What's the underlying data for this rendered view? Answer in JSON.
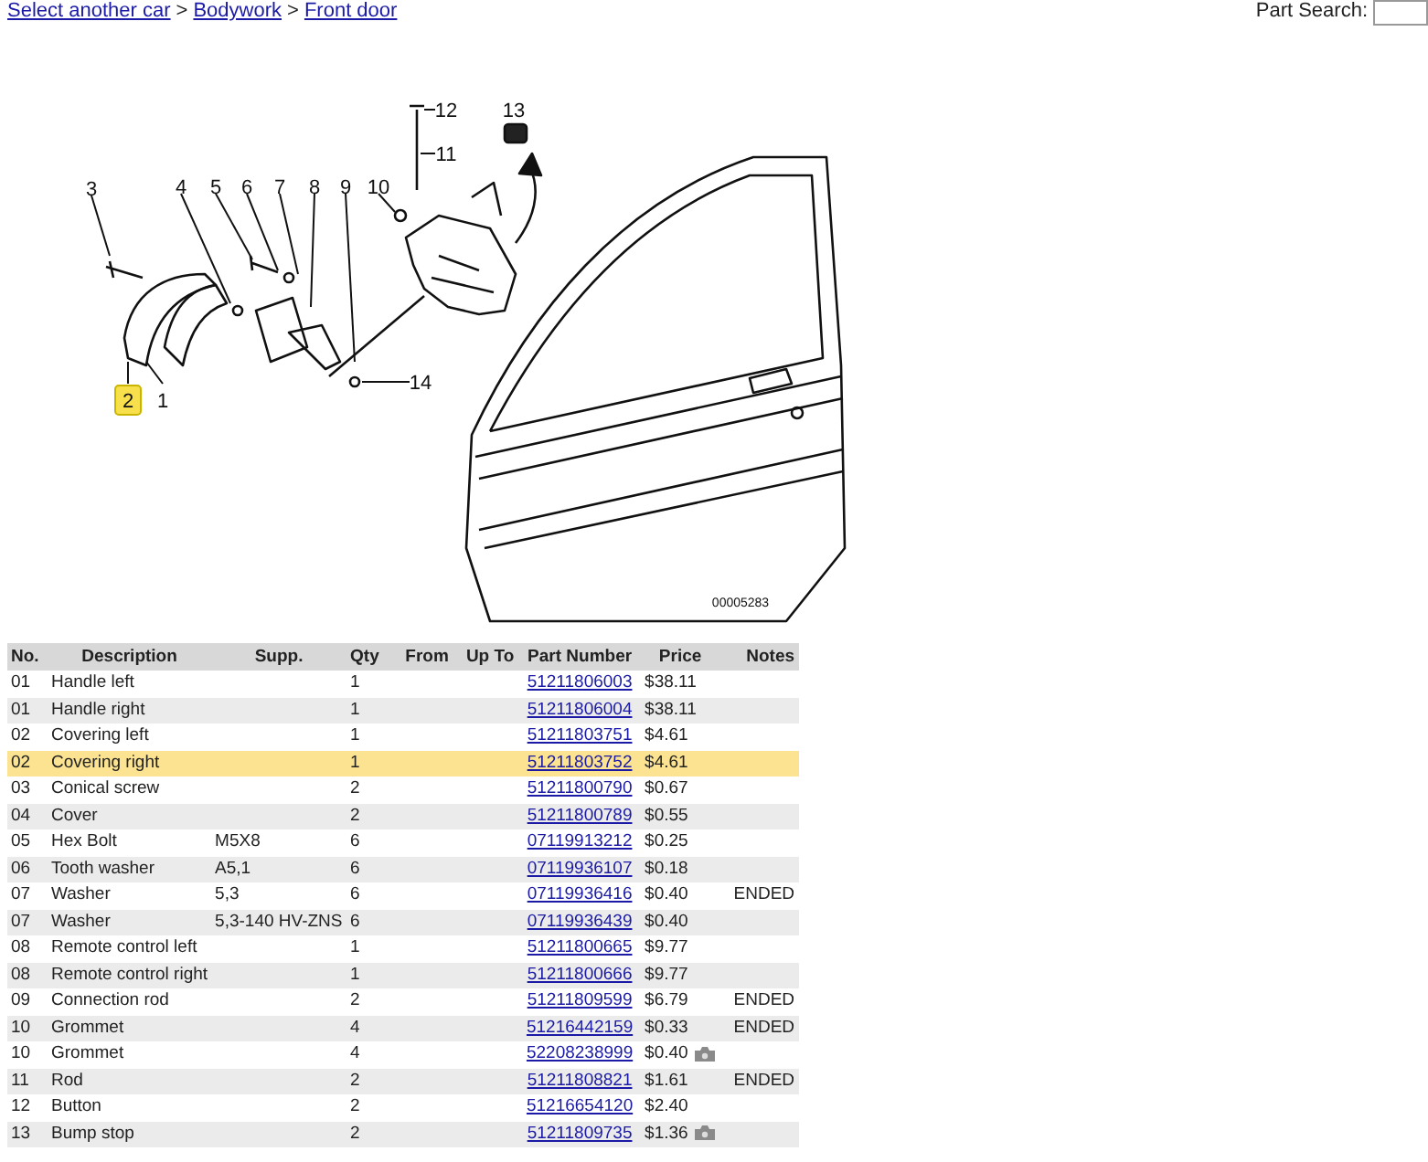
{
  "breadcrumb": [
    {
      "label": "Select another car"
    },
    {
      "label": "Bodywork"
    },
    {
      "label": "Front door"
    }
  ],
  "breadcrumb_separator": ">",
  "search": {
    "label": "Part Search:"
  },
  "diagram": {
    "code": "00005283",
    "callouts": [
      {
        "label": "3",
        "selected": false
      },
      {
        "label": "4",
        "selected": false
      },
      {
        "label": "5",
        "selected": false
      },
      {
        "label": "6",
        "selected": false
      },
      {
        "label": "7",
        "selected": false
      },
      {
        "label": "8",
        "selected": false
      },
      {
        "label": "9",
        "selected": false
      },
      {
        "label": "10",
        "selected": false
      },
      {
        "label": "12",
        "selected": false
      },
      {
        "label": "11",
        "selected": false
      },
      {
        "label": "13",
        "selected": false
      },
      {
        "label": "2",
        "selected": true
      },
      {
        "label": "1",
        "selected": false
      },
      {
        "label": "14",
        "selected": false
      }
    ]
  },
  "table": {
    "columns": [
      "No.",
      "Description",
      "Supp.",
      "Qty",
      "From",
      "Up To",
      "Part Number",
      "Price",
      "Notes"
    ],
    "rows": [
      {
        "no": "01",
        "description": "Handle left",
        "supp": "",
        "qty": "1",
        "part_number": "51211806003",
        "price": "$38.11",
        "notes": "",
        "photo": false,
        "selected": false
      },
      {
        "no": "01",
        "description": "Handle right",
        "supp": "",
        "qty": "1",
        "part_number": "51211806004",
        "price": "$38.11",
        "notes": "",
        "photo": false,
        "selected": false
      },
      {
        "no": "02",
        "description": "Covering left",
        "supp": "",
        "qty": "1",
        "part_number": "51211803751",
        "price": "$4.61",
        "notes": "",
        "photo": false,
        "selected": false
      },
      {
        "no": "02",
        "description": "Covering right",
        "supp": "",
        "qty": "1",
        "part_number": "51211803752",
        "price": "$4.61",
        "notes": "",
        "photo": false,
        "selected": true
      },
      {
        "no": "03",
        "description": "Conical screw",
        "supp": "",
        "qty": "2",
        "part_number": "51211800790",
        "price": "$0.67",
        "notes": "",
        "photo": false,
        "selected": false
      },
      {
        "no": "04",
        "description": "Cover",
        "supp": "",
        "qty": "2",
        "part_number": "51211800789",
        "price": "$0.55",
        "notes": "",
        "photo": false,
        "selected": false
      },
      {
        "no": "05",
        "description": "Hex Bolt",
        "supp": "M5X8",
        "qty": "6",
        "part_number": "07119913212",
        "price": "$0.25",
        "notes": "",
        "photo": false,
        "selected": false
      },
      {
        "no": "06",
        "description": "Tooth washer",
        "supp": "A5,1",
        "qty": "6",
        "part_number": "07119936107",
        "price": "$0.18",
        "notes": "",
        "photo": false,
        "selected": false
      },
      {
        "no": "07",
        "description": "Washer",
        "supp": "5,3",
        "qty": "6",
        "part_number": "07119936416",
        "price": "$0.40",
        "notes": "ENDED",
        "photo": false,
        "selected": false
      },
      {
        "no": "07",
        "description": "Washer",
        "supp": "5,3-140 HV-ZNS",
        "qty": "6",
        "part_number": "07119936439",
        "price": "$0.40",
        "notes": "",
        "photo": false,
        "selected": false
      },
      {
        "no": "08",
        "description": "Remote control left",
        "supp": "",
        "qty": "1",
        "part_number": "51211800665",
        "price": "$9.77",
        "notes": "",
        "photo": false,
        "selected": false
      },
      {
        "no": "08",
        "description": "Remote control right",
        "supp": "",
        "qty": "1",
        "part_number": "51211800666",
        "price": "$9.77",
        "notes": "",
        "photo": false,
        "selected": false
      },
      {
        "no": "09",
        "description": "Connection rod",
        "supp": "",
        "qty": "2",
        "part_number": "51211809599",
        "price": "$6.79",
        "notes": "ENDED",
        "photo": false,
        "selected": false
      },
      {
        "no": "10",
        "description": "Grommet",
        "supp": "",
        "qty": "4",
        "part_number": "51216442159",
        "price": "$0.33",
        "notes": "ENDED",
        "photo": false,
        "selected": false
      },
      {
        "no": "10",
        "description": "Grommet",
        "supp": "",
        "qty": "4",
        "part_number": "52208238999",
        "price": "$0.40",
        "notes": "",
        "photo": true,
        "selected": false
      },
      {
        "no": "11",
        "description": "Rod",
        "supp": "",
        "qty": "2",
        "part_number": "51211808821",
        "price": "$1.61",
        "notes": "ENDED",
        "photo": false,
        "selected": false
      },
      {
        "no": "12",
        "description": "Button",
        "supp": "",
        "qty": "2",
        "part_number": "51216654120",
        "price": "$2.40",
        "notes": "",
        "photo": false,
        "selected": false
      },
      {
        "no": "13",
        "description": "Bump stop",
        "supp": "",
        "qty": "2",
        "part_number": "51211809735",
        "price": "$1.36",
        "notes": "",
        "photo": true,
        "selected": false
      }
    ]
  }
}
